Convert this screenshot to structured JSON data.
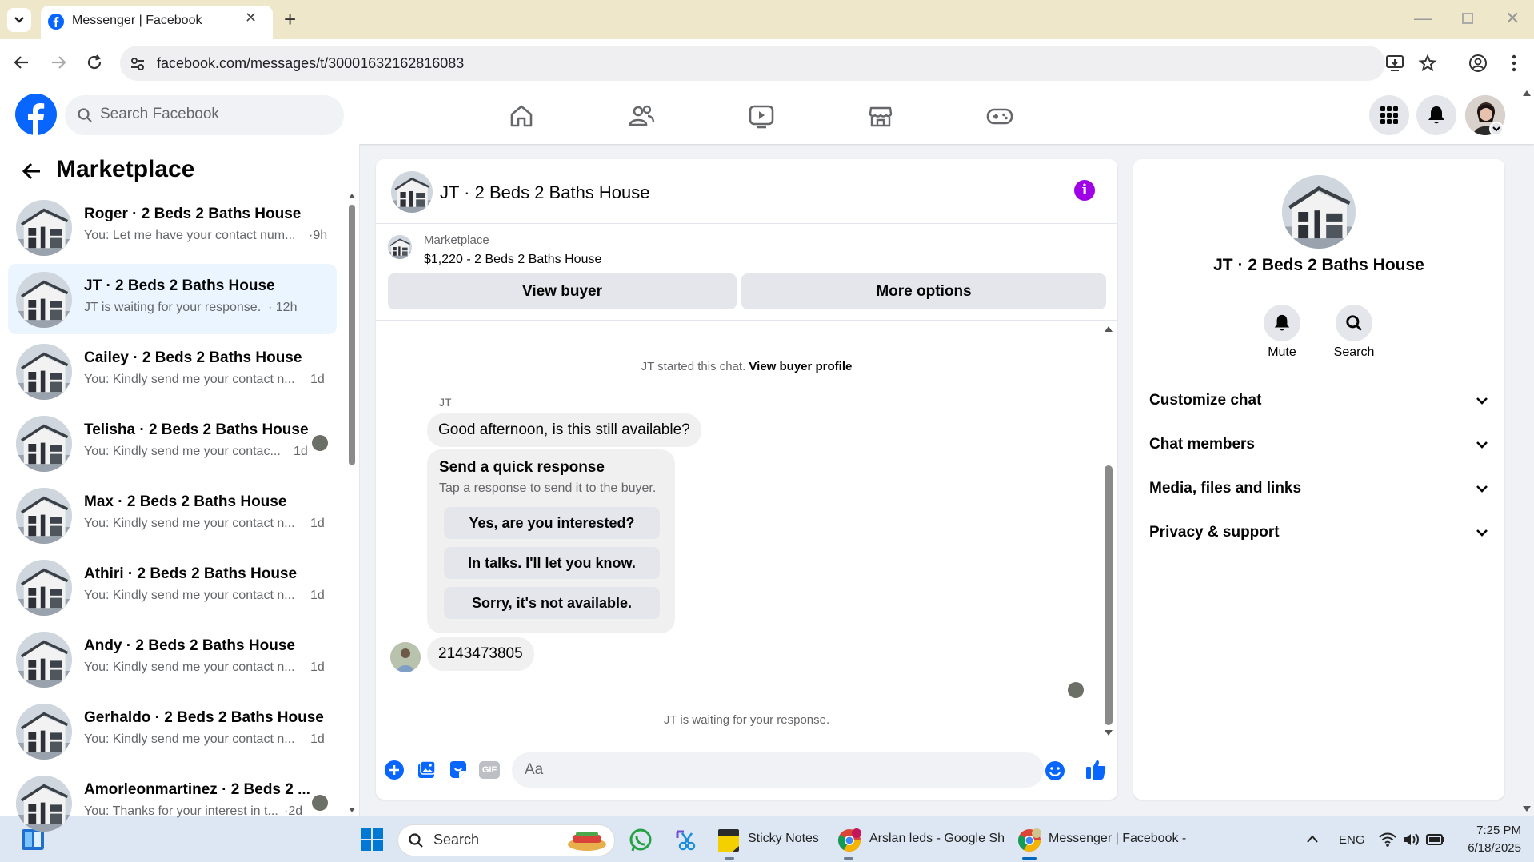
{
  "browser": {
    "tab_title": "Messenger | Facebook",
    "url": "facebook.com/messages/t/30001632162816083"
  },
  "header": {
    "search_placeholder": "Search Facebook"
  },
  "sidebar": {
    "title": "Marketplace",
    "conversations": [
      {
        "name": "Roger · 2 Beds 2 Baths House",
        "preview": "You: Let me have your contact num...",
        "time": "·9h"
      },
      {
        "name": "JT · 2 Beds 2 Baths House",
        "preview": "JT is waiting for your response.",
        "time": "· 12h"
      },
      {
        "name": "Cailey · 2 Beds 2 Baths House",
        "preview": "You: Kindly send me your contact n...",
        "time": "1d"
      },
      {
        "name": "Telisha · 2 Beds 2 Baths House",
        "preview": "You: Kindly send me your contac...",
        "time": "1d"
      },
      {
        "name": "Max · 2 Beds 2 Baths House",
        "preview": "You: Kindly send me your contact n...",
        "time": "1d"
      },
      {
        "name": "Athiri · 2 Beds 2 Baths House",
        "preview": "You: Kindly send me your contact n...",
        "time": "1d"
      },
      {
        "name": "Andy · 2 Beds 2 Baths House",
        "preview": "You: Kindly send me your contact n...",
        "time": "1d"
      },
      {
        "name": "Gerhaldo · 2 Beds 2 Baths House",
        "preview": "You: Kindly send me your contact n...",
        "time": "1d"
      },
      {
        "name": "Amorleonmartinez · 2 Beds 2 ...",
        "preview": "You: Thanks for your interest in t...",
        "time": "·2d"
      }
    ]
  },
  "chat": {
    "title": "JT · 2 Beds 2 Baths House",
    "marketplace_label": "Marketplace",
    "listing": "$1,220 - 2 Beds 2 Baths House",
    "view_buyer": "View buyer",
    "more_options": "More options",
    "started_text": "JT started this chat.",
    "view_profile": "View buyer profile",
    "sender": "JT",
    "message1": "Good afternoon, is this still available?",
    "quick_title": "Send a quick response",
    "quick_sub": "Tap a response to send it to the buyer.",
    "quick_responses": [
      "Yes, are you interested?",
      "In talks. I'll let you know.",
      "Sorry, it's not available."
    ],
    "message2": "2143473805",
    "waiting": "JT is waiting for your response.",
    "composer_placeholder": "Aa",
    "gif": "GIF"
  },
  "details": {
    "name": "JT · 2 Beds 2 Baths House",
    "mute": "Mute",
    "search": "Search",
    "sections": [
      "Customize chat",
      "Chat members",
      "Media, files and links",
      "Privacy & support"
    ]
  },
  "taskbar": {
    "search": "Search",
    "sticky": "Sticky Notes",
    "sheets": "Arslan leds - Google Sh",
    "messenger": "Messenger | Facebook -",
    "lang": "ENG",
    "time": "7:25 PM",
    "date": "6/18/2025"
  },
  "colors": {
    "fb_blue": "#0866ff",
    "active_conv": "#ebf5ff",
    "info_purple": "#a000e6",
    "tabstrip": "#efe7c9"
  }
}
